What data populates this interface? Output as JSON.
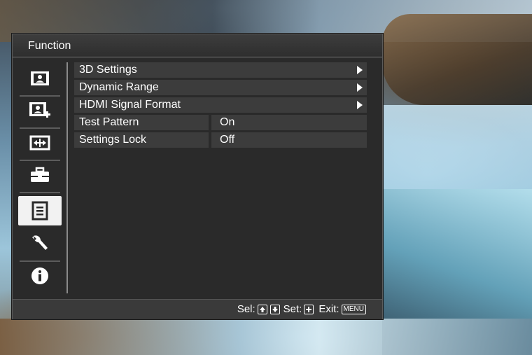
{
  "window": {
    "title": "Function"
  },
  "sidebar": {
    "items": [
      {
        "icon": "picture-icon",
        "active": false
      },
      {
        "icon": "picture-plus-icon",
        "active": false
      },
      {
        "icon": "screen-resize-icon",
        "active": false
      },
      {
        "icon": "toolbox-icon",
        "active": false
      },
      {
        "icon": "function-list-icon",
        "active": true
      },
      {
        "icon": "wrench-icon",
        "active": false
      },
      {
        "icon": "info-icon",
        "active": false
      }
    ]
  },
  "menu": {
    "items": [
      {
        "label": "3D Settings",
        "submenu": true
      },
      {
        "label": "Dynamic Range",
        "submenu": true
      },
      {
        "label": "HDMI Signal Format",
        "submenu": true
      },
      {
        "label": "Test Pattern",
        "value": "On"
      },
      {
        "label": "Settings Lock",
        "value": "Off"
      }
    ]
  },
  "footer": {
    "sel_label": "Sel:",
    "set_label": "Set:",
    "exit_label": "Exit:",
    "menu_key": "MENU"
  },
  "colors": {
    "panel_bg": "#2a2a2a",
    "row_bg": "#3c3c3c",
    "text": "#ffffff",
    "active_tab": "#f2f2f2"
  }
}
